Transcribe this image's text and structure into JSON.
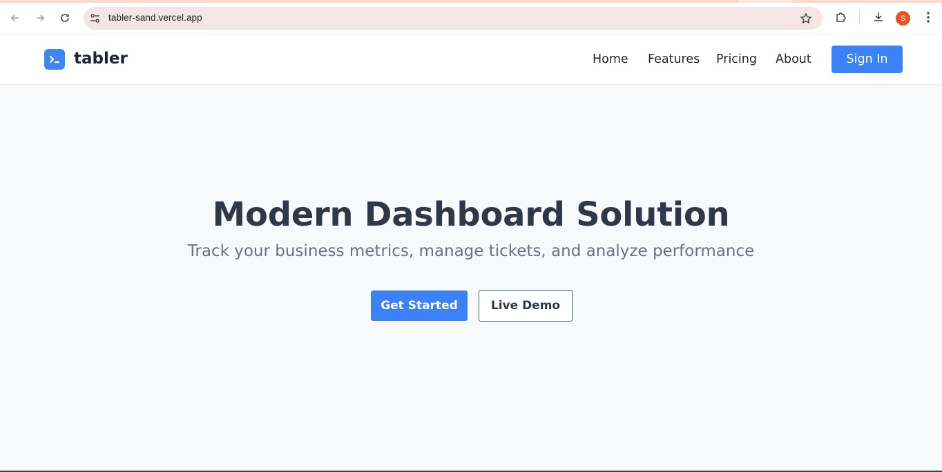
{
  "browser": {
    "url": "tabler-sand.vercel.app",
    "profile_initial": "S",
    "icons": [
      "back-arrow-icon",
      "forward-arrow-icon",
      "reload-icon",
      "site-settings-icon",
      "bookmark-star-icon",
      "extensions-icon",
      "download-icon",
      "kebab-menu-icon"
    ]
  },
  "header": {
    "brand": "tabler",
    "nav": [
      "Home",
      "Features",
      "Pricing",
      "About"
    ],
    "sign_in_label": "Sign In"
  },
  "hero": {
    "title": "Modern Dashboard Solution",
    "subtitle": "Track your business metrics, manage tickets, and analyze performance",
    "primary_cta": "Get Started",
    "secondary_cta": "Live Demo"
  },
  "colors": {
    "accent": "#3b82f6",
    "hero_background": "#f8f9fb",
    "title_text": "#2f3848",
    "subtitle_text": "#6a717e"
  }
}
